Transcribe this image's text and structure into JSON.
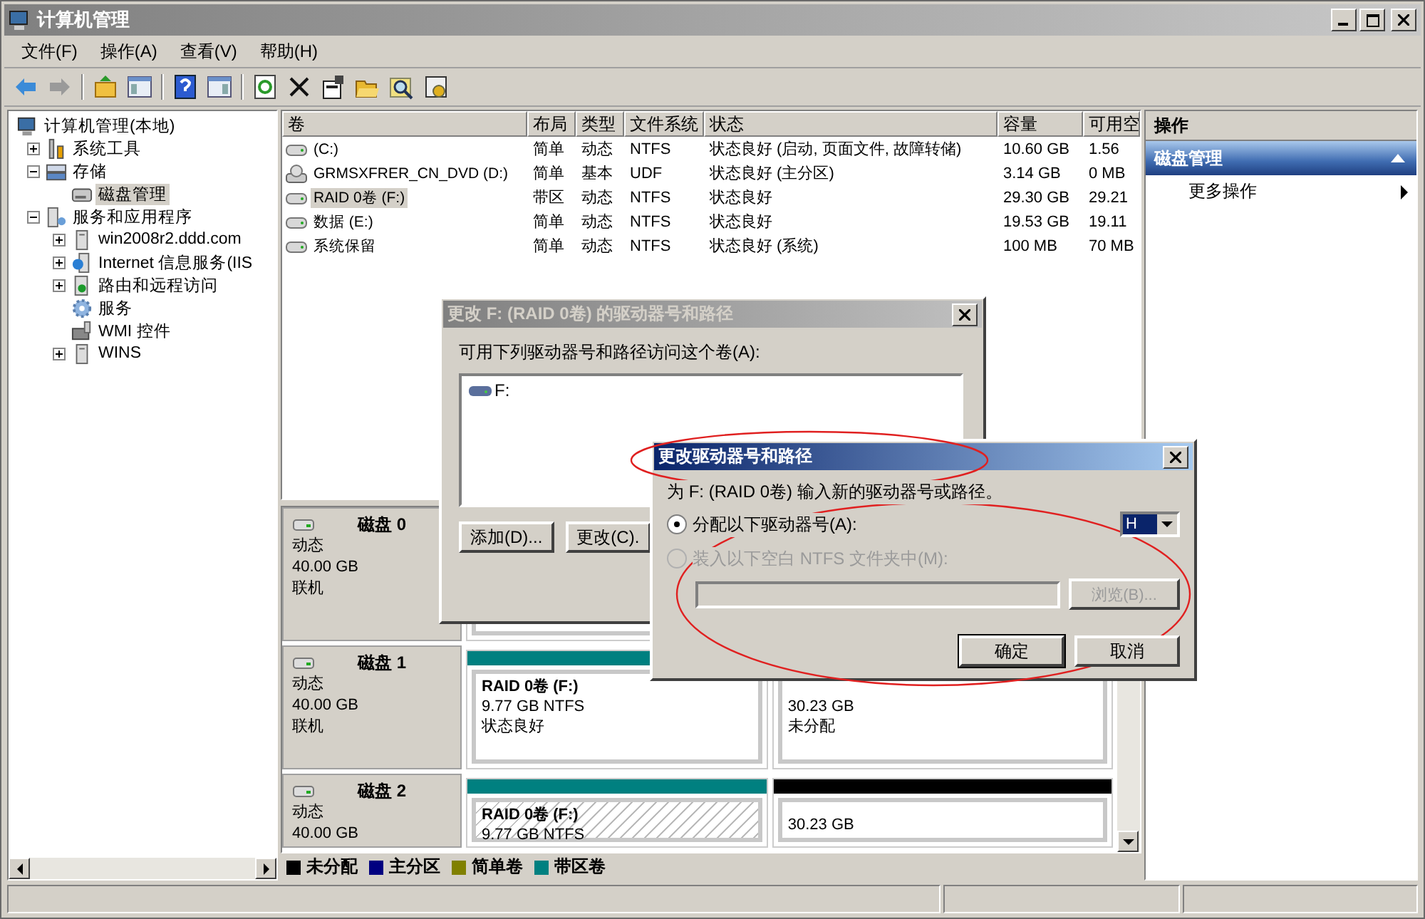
{
  "window": {
    "title": "计算机管理",
    "active": false
  },
  "menu": [
    "文件(F)",
    "操作(A)",
    "查看(V)",
    "帮助(H)"
  ],
  "tree": [
    {
      "label": "计算机管理(本地)",
      "kind": "computer",
      "selected": false,
      "children": [
        {
          "label": "系统工具",
          "kind": "tools",
          "selected": false,
          "expanded": false
        },
        {
          "label": "存储",
          "kind": "storage",
          "selected": false,
          "expanded": true,
          "children": [
            {
              "label": "磁盘管理",
              "kind": "disk",
              "selected": true
            }
          ]
        },
        {
          "label": "服务和应用程序",
          "kind": "apps",
          "selected": false,
          "expanded": true,
          "children": [
            {
              "label": "win2008r2.ddd.com",
              "kind": "server",
              "selected": false,
              "expanded": false
            },
            {
              "label": "Internet 信息服务(IIS",
              "kind": "iis",
              "selected": false,
              "expanded": false
            },
            {
              "label": "路由和远程访问",
              "kind": "routing",
              "selected": false,
              "expanded": false
            },
            {
              "label": "服务",
              "kind": "gear",
              "selected": false
            },
            {
              "label": "WMI 控件",
              "kind": "wmi",
              "selected": false
            },
            {
              "label": "WINS",
              "kind": "server",
              "selected": false,
              "expanded": false
            }
          ]
        }
      ]
    }
  ],
  "volumes": {
    "columns": [
      "卷",
      "布局",
      "类型",
      "文件系统",
      "状态",
      "容量",
      "可用空"
    ],
    "rows": [
      {
        "kind": "disk",
        "selected": false,
        "cells": [
          "(C:)",
          "简单",
          "动态",
          "NTFS",
          "状态良好 (启动, 页面文件, 故障转储)",
          "10.60 GB",
          "1.56"
        ]
      },
      {
        "kind": "dvd",
        "selected": false,
        "cells": [
          "GRMSXFRER_CN_DVD (D:)",
          "简单",
          "基本",
          "UDF",
          "状态良好 (主分区)",
          "3.14 GB",
          "0 MB"
        ]
      },
      {
        "kind": "disk",
        "selected": true,
        "cells": [
          "RAID 0卷 (F:)",
          "带区",
          "动态",
          "NTFS",
          "状态良好",
          "29.30 GB",
          "29.21"
        ]
      },
      {
        "kind": "disk",
        "selected": false,
        "cells": [
          "数据 (E:)",
          "简单",
          "动态",
          "NTFS",
          "状态良好",
          "19.53 GB",
          "19.11"
        ]
      },
      {
        "kind": "disk",
        "selected": false,
        "cells": [
          "系统保留",
          "简单",
          "动态",
          "NTFS",
          "状态良好 (系统)",
          "100 MB",
          "70 MB"
        ]
      }
    ]
  },
  "disks": [
    {
      "name": "磁盘 0",
      "type": "动态",
      "size": "40.00 GB",
      "status": "联机"
    },
    {
      "name": "磁盘 1",
      "type": "动态",
      "size": "40.00 GB",
      "status": "联机",
      "partitions": [
        {
          "kind": "striped",
          "selected": false,
          "name": "RAID 0卷 (F:)",
          "detail": "9.77 GB NTFS",
          "status": "状态良好"
        },
        {
          "kind": "unallocated",
          "selected": false,
          "detail": "30.23 GB",
          "status": "未分配"
        }
      ]
    },
    {
      "name": "磁盘 2",
      "type": "动态",
      "size": "40.00 GB",
      "partitions": [
        {
          "kind": "striped",
          "selected": true,
          "name": "RAID 0卷 (F:)",
          "detail": "9.77 GB NTFS"
        },
        {
          "kind": "unallocated",
          "selected": false,
          "detail": "30.23 GB"
        }
      ]
    }
  ],
  "legend": [
    {
      "label": "未分配",
      "color": "#000000"
    },
    {
      "label": "主分区",
      "color": "#000080"
    },
    {
      "label": "简单卷",
      "color": "#808000"
    },
    {
      "label": "带区卷",
      "color": "#008080"
    }
  ],
  "actions": {
    "header": "操作",
    "sections": [
      {
        "title": "磁盘管理",
        "expanded": true,
        "items": [
          {
            "label": "更多操作"
          }
        ]
      }
    ]
  },
  "path_dialog": {
    "title": "更改 F: (RAID 0卷) 的驱动器号和路径",
    "active": false,
    "prompt": "可用下列驱动器号和路径访问这个卷(A):",
    "paths": [
      "F:"
    ],
    "buttons": [
      "添加(D)...",
      "更改(C)."
    ]
  },
  "letter_dialog": {
    "title": "更改驱动器号和路径",
    "active": true,
    "prompt": "为 F: (RAID 0卷) 输入新的驱动器号或路径。",
    "options": [
      {
        "kind": "letter",
        "label": "分配以下驱动器号(A):",
        "selected": true,
        "disabled": false,
        "value": "H"
      },
      {
        "kind": "folder",
        "label": "装入以下空白 NTFS 文件夹中(M):",
        "selected": false,
        "disabled": true,
        "button": "浏览(B)..."
      }
    ],
    "buttons": [
      "确定",
      "取消"
    ]
  }
}
